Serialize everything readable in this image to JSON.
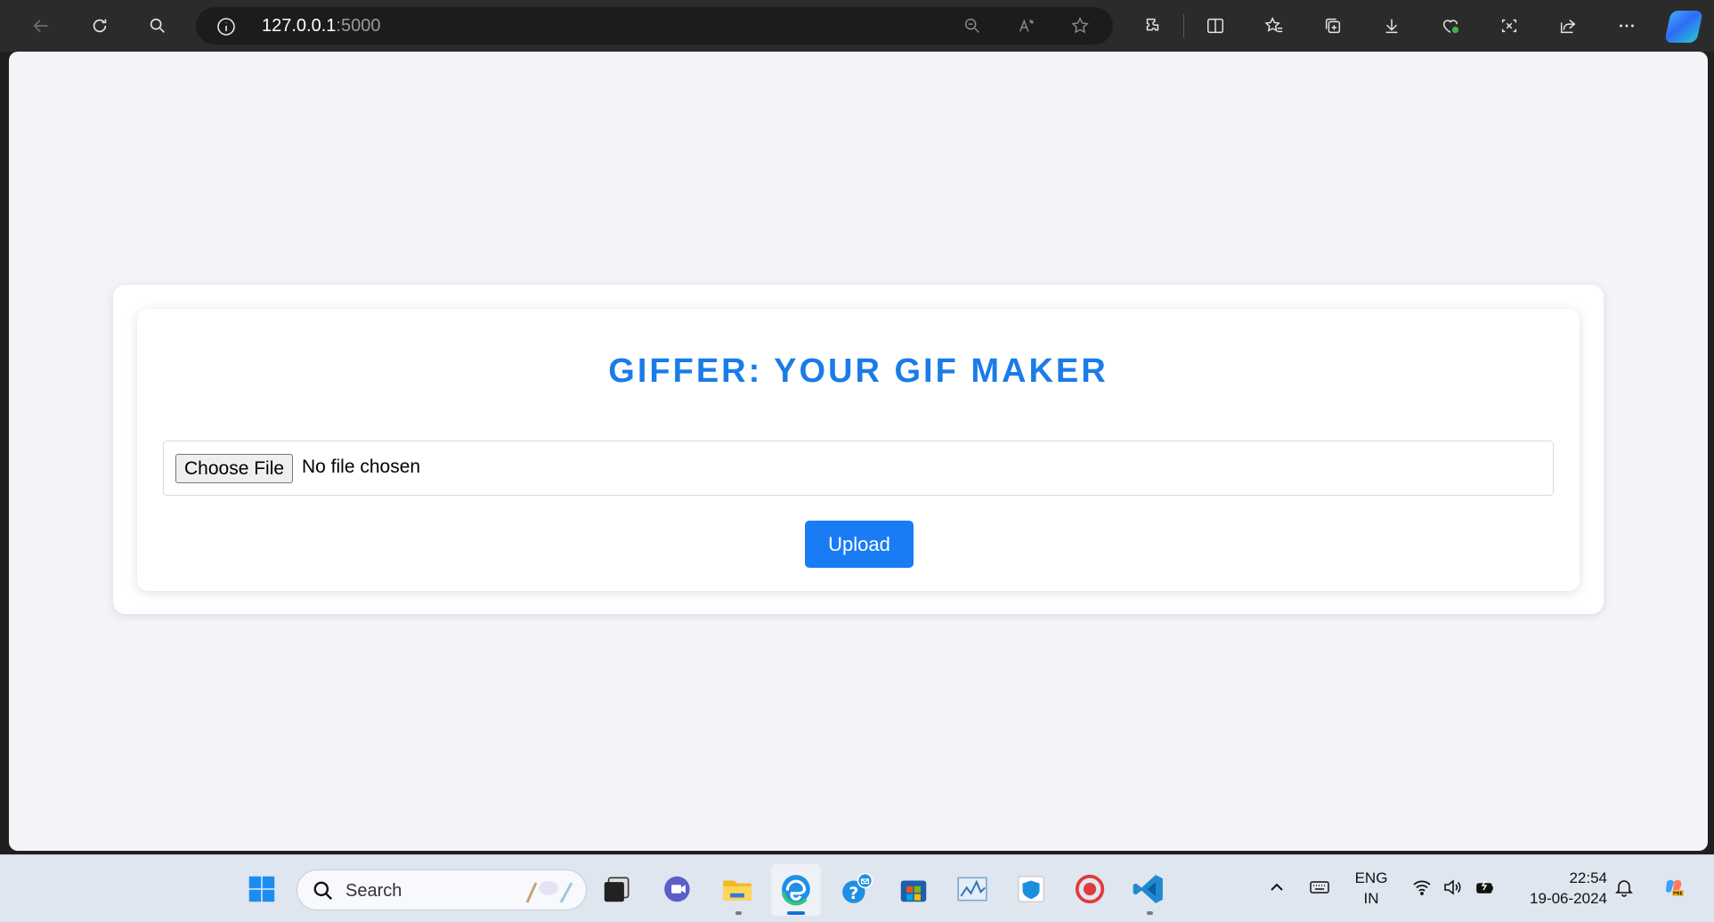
{
  "browser": {
    "address": {
      "host": "127.0.0.1",
      "port": ":5000"
    },
    "icons": [
      "back-icon",
      "refresh-icon",
      "search-icon",
      "info-icon",
      "zoom-out-icon",
      "read-aloud-icon",
      "favorite-star-icon",
      "extensions-icon",
      "split-screen-icon",
      "favorites-icon",
      "collections-icon",
      "download-icon",
      "browser-essentials-icon",
      "screenshot-icon",
      "share-icon",
      "more-icon",
      "copilot-icon"
    ]
  },
  "page": {
    "title": "GIFFER: YOUR GIF MAKER",
    "file_input": {
      "button_label": "Choose File",
      "status": "No file chosen"
    },
    "upload_label": "Upload",
    "accent_color": "#1a7cf5"
  },
  "taskbar": {
    "search_label": "Search",
    "language": {
      "line1": "ENG",
      "line2": "IN"
    },
    "time": "22:54",
    "date": "19-06-2024"
  }
}
